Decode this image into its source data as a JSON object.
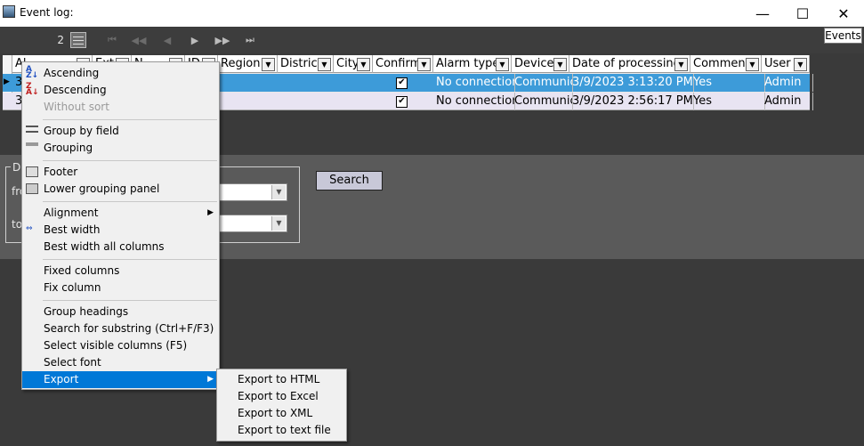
{
  "window": {
    "title": "Event log:",
    "minimize_glyph": "—",
    "maximize_glyph": "☐",
    "close_glyph": "✕"
  },
  "toolbar": {
    "page_number": "2",
    "nav_icons": [
      "first-page-icon",
      "previous-page-fast-icon",
      "previous-icon",
      "next-icon",
      "next-page-fast-icon",
      "last-page-icon"
    ],
    "events_button": "Events"
  },
  "grid": {
    "columns": [
      {
        "label": "Al"
      },
      {
        "label": "Ext"
      },
      {
        "label": "N"
      },
      {
        "label": "ID"
      },
      {
        "label": "Region"
      },
      {
        "label": "District"
      },
      {
        "label": "City"
      },
      {
        "label": "Confirm"
      },
      {
        "label": "Alarm type"
      },
      {
        "label": "Device"
      },
      {
        "label": "Date of processing"
      },
      {
        "label": "Comment"
      },
      {
        "label": "User"
      }
    ],
    "rows": [
      {
        "first": "3",
        "confirm": true,
        "alarm_type": "No connection",
        "device": "Communic",
        "date": "3/9/2023 3:13:20 PM",
        "comment": "Yes",
        "user": "Admin",
        "selected": true
      },
      {
        "first": "3",
        "confirm": true,
        "alarm_type": "No connection",
        "device": "Communic",
        "date": "3/9/2023 2:56:17 PM",
        "comment": "Yes",
        "user": "Admin",
        "selected": false
      }
    ],
    "selected_row_color": "#3d9bd9",
    "normal_row_color": "#e8e4f2"
  },
  "filter": {
    "group_label": "D",
    "from_label": "fro",
    "to_label": "to",
    "search_button": "Search"
  },
  "context_menu": {
    "items": [
      {
        "label": "Ascending",
        "icon": "sort-ascending-icon"
      },
      {
        "label": "Descending",
        "icon": "sort-descending-icon"
      },
      {
        "label": "Without sort",
        "disabled": true
      },
      {
        "label": "Group by field",
        "icon": "group-by-field-icon"
      },
      {
        "label": "Grouping",
        "icon": "grouping-icon"
      },
      {
        "label": "Footer",
        "icon": "footer-icon"
      },
      {
        "label": "Lower grouping panel",
        "icon": "lower-panel-icon"
      },
      {
        "label": "Alignment",
        "submenu": true
      },
      {
        "label": "Best width",
        "icon": "best-width-icon"
      },
      {
        "label": "Best width all columns"
      },
      {
        "label": "Fixed columns"
      },
      {
        "label": "Fix column"
      },
      {
        "label": "Group headings"
      },
      {
        "label": "Search for substring (Ctrl+F/F3)"
      },
      {
        "label": "Select visible columns (F5)"
      },
      {
        "label": "Select font"
      },
      {
        "label": "Export",
        "submenu": true,
        "highlighted": true
      }
    ],
    "submenu_arrow": "▶"
  },
  "export_submenu": {
    "items": [
      "Export to HTML",
      "Export to Excel",
      "Export to XML",
      "Export to text file"
    ]
  },
  "colors": {
    "highlight": "#0078d7",
    "toolbar_bg": "#3d3d3d",
    "panel_bg": "#5a5a5a"
  }
}
